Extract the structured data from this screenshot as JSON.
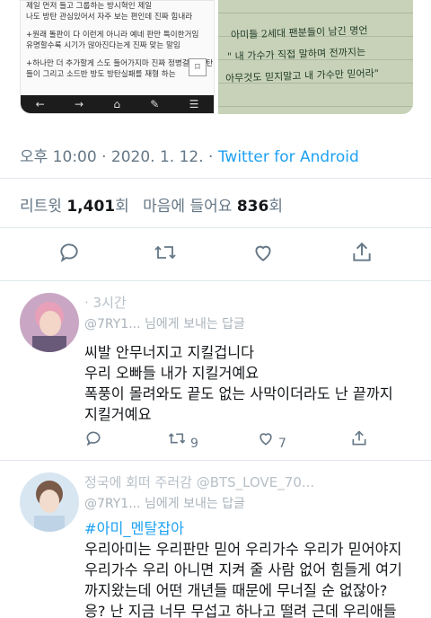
{
  "media": {
    "left_lines": [
      "제일 먼저 들고 그룹하는 방시혁인 제일",
      "나도 방탄 관심있어서 자주 보는 편인데 진짜 힘내라",
      "",
      "+원래 돌판이 다 이런게 아니라 예네 판만 특이한거임",
      "유명할수록 시기가 많아진다는게 진짜 맞는 말임",
      "",
      "+하나만 더 추가할게 스도 들어가지마 진짜 정병걸려 방탄 팬",
      "들이 그리고 소드반 방도 방탄실패를 재형 하는"
    ],
    "right_lines": [
      "아미들 2세대 팬분들이 남긴 명언",
      "\" 내 가수가 직접 말하며 전까지는",
      "아무것도 믿지말고 내 가수만 믿어라\""
    ]
  },
  "tweet": {
    "meta_time": "오후 10:00 · 2020. 1. 12. · ",
    "meta_source": "Twitter for Android",
    "retweets_label": "리트윗 ",
    "retweets_count": "1,401",
    "retweets_unit": "회",
    "likes_label": "마음에 들어요 ",
    "likes_count": "836",
    "likes_unit": "회"
  },
  "replies": [
    {
      "header": "                              · 3시간",
      "subheader": "@7RY1... 님에게 보내는 답글",
      "lines": [
        "씨발 안무너지고 지킬겁니다",
        "우리 오빠들 내가 지킬거예요",
        "폭풍이 몰려와도 끝도 없는 사막이더라도 난 끝까지",
        "지킬거예요"
      ],
      "hashtag": "",
      "retweet_count": "9",
      "like_count": "7"
    },
    {
      "header": "정국에 회떠 주러감 @BTS_LOVE_70...",
      "subheader": "@7RY1... 님에게 보내는 답글",
      "hashtag": "#아미_멘탈잡아",
      "lines": [
        "우리아미는 우리판만 믿어 우리가수 우리가 믿어야지",
        "우리가수 우리 아니면 지켜 줄 사람 없어 힘들게 여기",
        "까지왔는데 어떤 개년들 때문에 무너질 순 없잖아?",
        "응? 난 지금 너무 무섭고 하나고 떨려 근데 우리애들"
      ]
    }
  ]
}
